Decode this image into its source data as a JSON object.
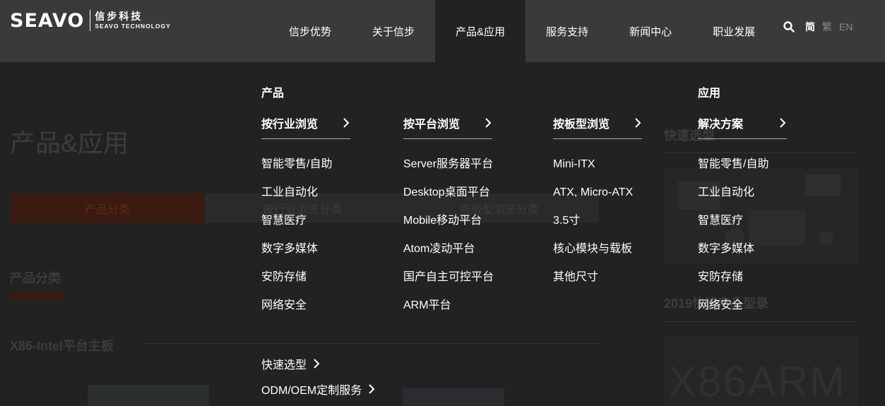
{
  "header": {
    "logo_mark": "SEAVO",
    "logo_cn": "信步科技",
    "logo_en": "SEAVO TECHNOLOGY",
    "nav": [
      {
        "label": "信步优势"
      },
      {
        "label": "关于信步"
      },
      {
        "label": "产品&应用",
        "active": true
      },
      {
        "label": "服务支持"
      },
      {
        "label": "新闻中心"
      },
      {
        "label": "职业发展"
      }
    ],
    "search_icon": "search-icon",
    "languages": [
      {
        "label": "简",
        "active": true
      },
      {
        "label": "繁"
      },
      {
        "label": "EN"
      }
    ]
  },
  "background_page": {
    "title": "产品&应用",
    "tab_product": "产品分类",
    "tab_industry": "按行业浏览分类",
    "tab_board": "按板型浏览分类",
    "section": "产品分类",
    "subsection": "X86-Intel平台主板",
    "side_title": "快速选型",
    "side_title2": "2019快速产品型录",
    "side_banner": "X86ARM"
  },
  "menu": {
    "product_label": "产品",
    "app_label": "应用",
    "columns": [
      {
        "heading": "按行业浏览",
        "items": [
          "智能零售/自助",
          "工业自动化",
          "智慧医疗",
          "数字多媒体",
          "安防存储",
          "网络安全"
        ]
      },
      {
        "heading": "按平台浏览",
        "items": [
          "Server服务器平台",
          "Desktop桌面平台",
          "Mobile移动平台",
          "Atom凌动平台",
          "国产自主可控平台",
          "ARM平台"
        ]
      },
      {
        "heading": "按板型浏览",
        "items": [
          "Mini-ITX",
          "ATX, Micro-ATX",
          "3.5寸",
          "核心模块与载板",
          "其他尺寸"
        ]
      },
      {
        "heading": "解决方案",
        "items": [
          "智能零售/自助",
          "工业自动化",
          "智慧医疗",
          "数字多媒体",
          "安防存储",
          "网络安全"
        ]
      }
    ],
    "quick_select": "快速选型",
    "odm_service": "ODM/OEM定制服务"
  }
}
